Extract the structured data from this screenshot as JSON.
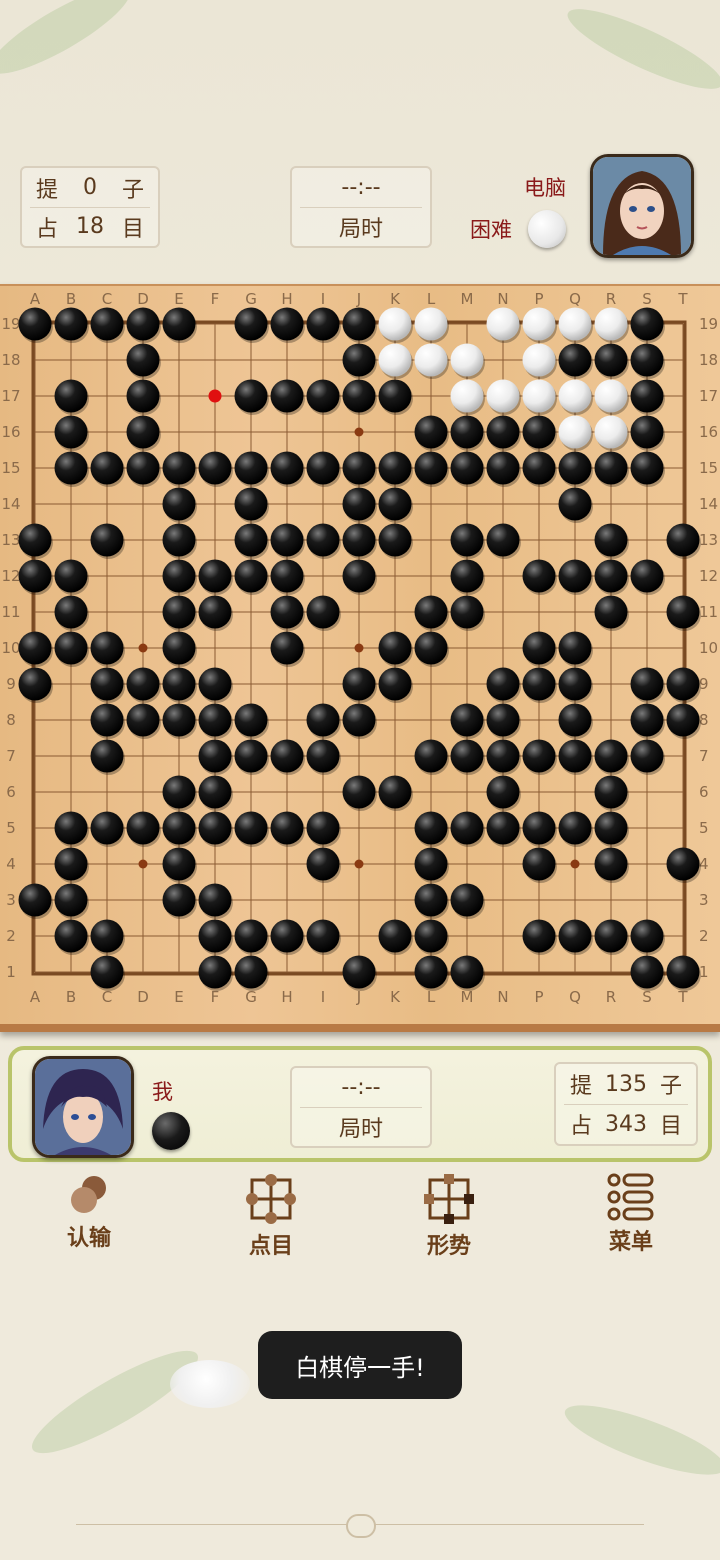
{
  "opponent": {
    "captures_prefix": "提",
    "captures_value": "0",
    "captures_unit": "子",
    "territory_prefix": "占",
    "territory_value": "18",
    "territory_unit": "目",
    "name": "电脑",
    "level": "困难",
    "stone_color": "white",
    "timer_value": "--:--",
    "timer_label": "局时"
  },
  "self": {
    "name": "我",
    "stone_color": "black",
    "timer_value": "--:--",
    "timer_label": "局时",
    "captures_prefix": "提",
    "captures_value": "135",
    "captures_unit": "子",
    "territory_prefix": "占",
    "territory_value": "343",
    "territory_unit": "目"
  },
  "board": {
    "size": 19,
    "columns": [
      "A",
      "B",
      "C",
      "D",
      "E",
      "F",
      "G",
      "H",
      "J",
      "K",
      "L",
      "M",
      "N",
      "P",
      "Q",
      "R",
      "S",
      "T"
    ],
    "column_labels": [
      "A",
      "B",
      "C",
      "D",
      "E",
      "F",
      "G",
      "H",
      "I",
      "J",
      "K",
      "L",
      "M",
      "N",
      "P",
      "Q",
      "R",
      "S",
      "T"
    ],
    "row_labels": [
      "19",
      "18",
      "17",
      "16",
      "15",
      "14",
      "13",
      "12",
      "11",
      "10",
      "9",
      "8",
      "7",
      "6",
      "5",
      "4",
      "3",
      "2",
      "1"
    ],
    "last_move": "F17",
    "rows": [
      "BBBBB.BBBBWW.WWWWB.",
      "...B.....BWWW.WBBB.",
      ".B.B..BBBBB.WWWWWB.",
      ".B.B.......BBBBWWB.",
      ".BBBBBBBBBBBBBBBBB.",
      "....B.B..BB....B...B",
      "B.B.B.BBBBB.BB..B.B",
      "BB..BBBB.B..B.BBBB.",
      ".B..BB.BB..BB...B.B",
      "BBB.B..B..BB..BB...",
      "B.BBBB...BB..BBB.BB",
      "..BBBBB.BB..BB.B.BB",
      "..B..BBBB..BBBBBBB.",
      "....BB...BB..B..B..",
      ".BBBBBBBB..BBBBBB..",
      ".B..B...B..B..B.B.B",
      "BB..BB.....BB......",
      ".BB..BBBB.BB..BBBB.B",
      "..B..BB..B.BB....BBB"
    ]
  },
  "actions": [
    {
      "label": "认输",
      "icon": "resign-icon"
    },
    {
      "label": "点目",
      "icon": "count-icon"
    },
    {
      "label": "形势",
      "icon": "situation-icon"
    },
    {
      "label": "菜单",
      "icon": "menu-icon"
    }
  ],
  "toast": "白棋停一手!"
}
